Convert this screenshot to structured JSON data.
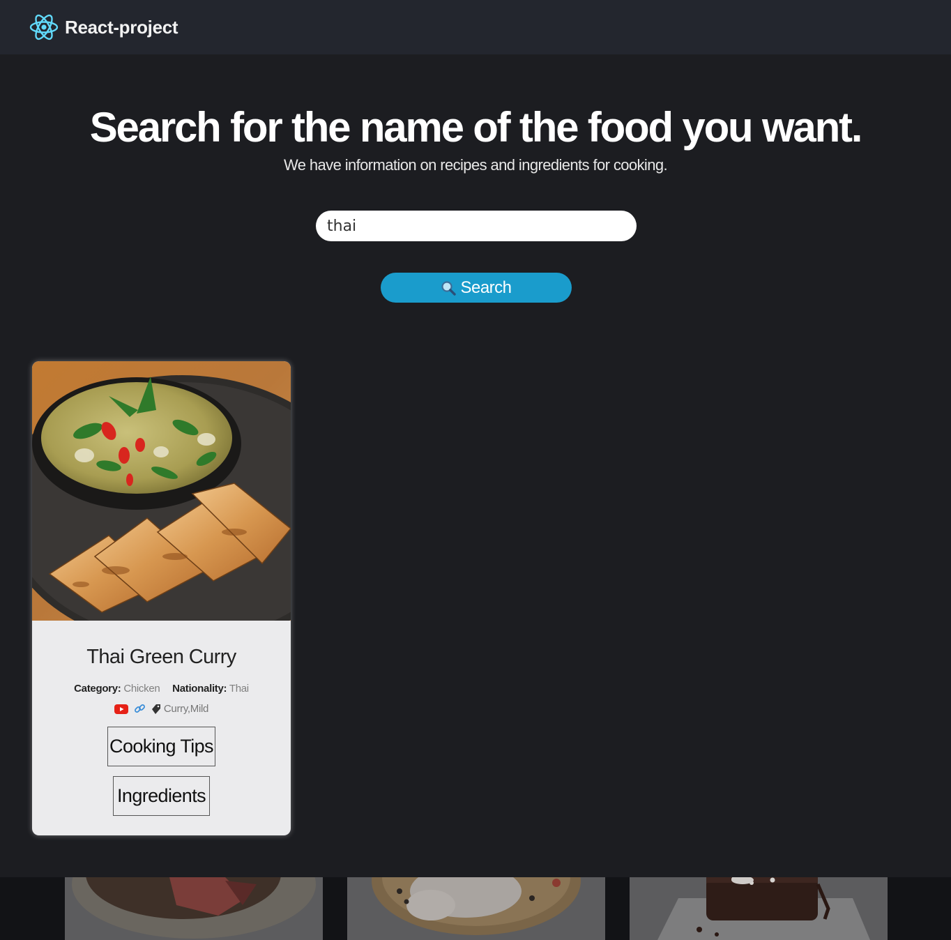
{
  "navbar": {
    "brand_name": "React-project",
    "logo_icon": "react-atom-icon",
    "accent_color": "#61dafb"
  },
  "hero": {
    "title": "Search for the name of the food you want.",
    "subtitle": "We have information on recipes and ingredients for cooking."
  },
  "search": {
    "value": "thai",
    "button_label": "Search",
    "button_icon": "magnifier-icon",
    "button_color": "#1a9ccc"
  },
  "recipe": {
    "title": "Thai Green Curry",
    "category_label": "Category:",
    "category_value": "Chicken",
    "nationality_label": "Nationality:",
    "nationality_value": "Thai",
    "tags": "Curry,Mild",
    "links": [
      "youtube-icon",
      "link-icon",
      "tag-icon"
    ],
    "buttons": {
      "cooking_tips": "Cooking Tips",
      "ingredients": "Ingredients"
    }
  },
  "carousel": {
    "thumbnails": [
      "roast-beef",
      "raw-chicken",
      "chocolate-cake"
    ]
  }
}
